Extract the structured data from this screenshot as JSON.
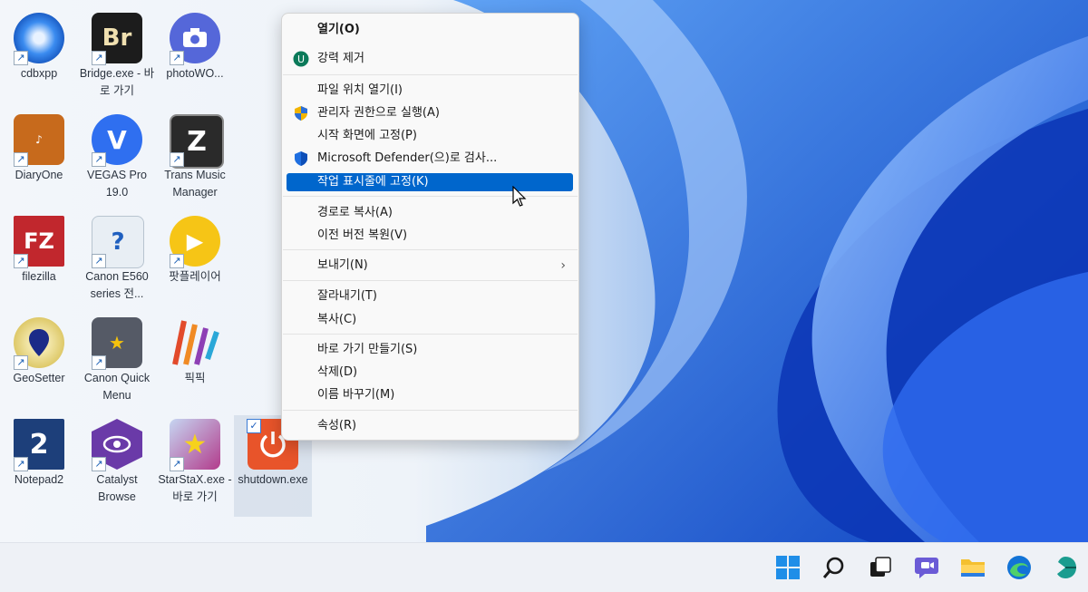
{
  "desktop": {
    "icons": [
      {
        "label": "cdbxpp",
        "icon": "disc-burner-icon",
        "color": "#2b7fe0"
      },
      {
        "label": "Bridge.exe - 바로 가기",
        "icon": "bridge-br-icon",
        "color": "#1c1c1c",
        "glyph": "Br"
      },
      {
        "label": "photoWO...",
        "icon": "camera-icon",
        "color": "#5567d9"
      },
      {
        "label": "DiaryOne",
        "icon": "diary-icon",
        "color": "#c76a1c"
      },
      {
        "label": "VEGAS Pro 19.0",
        "icon": "vegas-v-icon",
        "color": "#2f6ff0",
        "glyph": "V"
      },
      {
        "label": "Trans Music Manager",
        "icon": "music-z-icon",
        "color": "#2a2a2a",
        "glyph": "Z"
      },
      {
        "label": "filezilla",
        "icon": "filezilla-icon",
        "color": "#c1272d",
        "glyph": "FZ"
      },
      {
        "label": "Canon E560 series 전...",
        "icon": "printer-help-icon",
        "color": "#e8eef4",
        "glyph": "?"
      },
      {
        "label": "팟플레이어",
        "icon": "play-icon",
        "color": "#f6c516",
        "glyph": "▶"
      },
      {
        "label": "GeoSetter",
        "icon": "map-pin-icon",
        "color": "#d9c25a"
      },
      {
        "label": "Canon Quick Menu",
        "icon": "canon-menu-icon",
        "color": "#555a66",
        "glyph": "★"
      },
      {
        "label": "픽픽",
        "icon": "picpick-icon",
        "color": "#f2f5f9"
      },
      {
        "label": "Notepad2",
        "icon": "notepad-icon",
        "color": "#1d3f7a",
        "glyph": "2"
      },
      {
        "label": "Catalyst Browse",
        "icon": "eye-icon",
        "color": "#6a3aa8"
      },
      {
        "label": "StarStaX.exe - 바로 가기",
        "icon": "star-icon",
        "color": "#b23c8c"
      },
      {
        "label": "shutdown.exe",
        "icon": "power-icon",
        "color": "#e8542a"
      }
    ]
  },
  "menu": {
    "items": [
      {
        "label": "열기(O)",
        "icon": ""
      },
      {
        "label": "강력 제거",
        "icon": "uninstall-icon"
      },
      {
        "label": "파일 위치 열기(I)",
        "icon": ""
      },
      {
        "label": "관리자 권한으로 실행(A)",
        "icon": "uac-shield-icon"
      },
      {
        "label": "시작 화면에 고정(P)",
        "icon": ""
      },
      {
        "label": "Microsoft Defender(으)로 검사...",
        "icon": "defender-shield-icon"
      },
      {
        "label": "작업 표시줄에 고정(K)",
        "icon": ""
      },
      {
        "label": "경로로 복사(A)",
        "icon": ""
      },
      {
        "label": "이전 버전 복원(V)",
        "icon": ""
      },
      {
        "label": "보내기(N)",
        "icon": "",
        "submenu_glyph": "›"
      },
      {
        "label": "잘라내기(T)",
        "icon": ""
      },
      {
        "label": "복사(C)",
        "icon": ""
      },
      {
        "label": "바로 가기 만들기(S)",
        "icon": ""
      },
      {
        "label": "삭제(D)",
        "icon": ""
      },
      {
        "label": "이름 바꾸기(M)",
        "icon": ""
      },
      {
        "label": "속성(R)",
        "icon": ""
      }
    ],
    "highlighted": "작업 표시줄에 고정(K)"
  },
  "taskbar": {
    "buttons": [
      "start-icon",
      "search-icon",
      "task-view-icon",
      "chat-icon",
      "file-explorer-icon",
      "edge-icon",
      "app-icon"
    ]
  },
  "colors": {
    "highlight": "#0066cc",
    "accent": "#1f6fe0"
  }
}
